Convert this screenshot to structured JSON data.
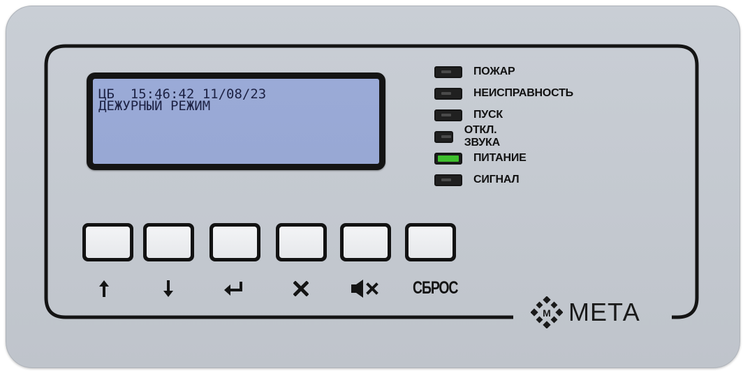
{
  "display": {
    "line1": "ЦБ  15:46:42 11/08/23",
    "line2": "ДЕЖУРНЫЙ РЕЖИМ"
  },
  "indicators": [
    {
      "label": "ПОЖАР",
      "state": "off"
    },
    {
      "label": "НЕИСПРАВНОСТЬ",
      "state": "off"
    },
    {
      "label": "ПУСК",
      "state": "off"
    },
    {
      "label": "ОТКЛ. ЗВУКА",
      "state": "off"
    },
    {
      "label": "ПИТАНИЕ",
      "state": "on"
    },
    {
      "label": "СИГНАЛ",
      "state": "off"
    }
  ],
  "buttons": [
    {
      "icon": "arrow-up-icon"
    },
    {
      "icon": "arrow-down-icon"
    },
    {
      "icon": "enter-icon"
    },
    {
      "icon": "cancel-icon"
    },
    {
      "icon": "mute-icon"
    },
    {
      "label": "СБРОС"
    }
  ],
  "brand": {
    "name": "МЕТА",
    "logo_text": "М"
  },
  "colors": {
    "panel": "#c6cbd2",
    "lcd_background": "#9aaad7",
    "lcd_text": "#1d2244",
    "led_on": "#3fbf2e",
    "led_off": "#202020"
  }
}
